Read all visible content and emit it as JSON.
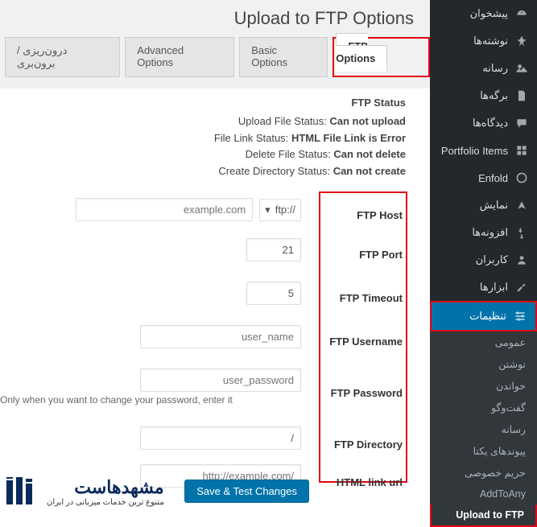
{
  "sidebar": {
    "items": [
      {
        "label": "پیشخوان",
        "icon": "dashboard-icon"
      },
      {
        "label": "نوشته‌ها",
        "icon": "pin-icon"
      },
      {
        "label": "رسانه",
        "icon": "media-icon"
      },
      {
        "label": "برگه‌ها",
        "icon": "page-icon"
      },
      {
        "label": "دیدگاه‌ها",
        "icon": "comment-icon"
      },
      {
        "label": "Portfolio Items",
        "icon": "gallery-icon"
      },
      {
        "label": "Enfold",
        "icon": "enfold-icon"
      },
      {
        "label": "نمایش",
        "icon": "appearance-icon"
      },
      {
        "label": "افزونه‌ها",
        "icon": "plugin-icon"
      },
      {
        "label": "کاربران",
        "icon": "users-icon"
      },
      {
        "label": "ابزارها",
        "icon": "tools-icon"
      },
      {
        "label": "تنظیمات",
        "icon": "settings-icon"
      }
    ],
    "subs": [
      "عمومی",
      "نوشتن",
      "خواندن",
      "گفت‌وگو",
      "رسانه",
      "پیوندهای یکتا",
      "حریم خصوصی",
      "AddToAny",
      "Upload to FTP"
    ]
  },
  "page": {
    "title": "Upload to FTP Options"
  },
  "tabs": [
    {
      "label": "درون‌ریزی / برون‌بری"
    },
    {
      "label": "Advanced Options"
    },
    {
      "label": "Basic Options"
    },
    {
      "label": "FTP Options",
      "active": true
    }
  ],
  "status": {
    "heading": "FTP Status",
    "lines": [
      {
        "label": "Upload File Status:",
        "value": "Can not upload"
      },
      {
        "label": "File Link Status:",
        "value": "HTML File Link is Error"
      },
      {
        "label": "Delete File Status:",
        "value": "Can not delete"
      },
      {
        "label": "Create Directory Status:",
        "value": "Can not create"
      }
    ]
  },
  "form": {
    "labels": [
      "FTP Host",
      "FTP Port",
      "FTP Timeout",
      "FTP Username",
      "FTP Password",
      "FTP Directory",
      "HTML link url"
    ],
    "protocol": "ftp:// ",
    "host_placeholder": "example.com",
    "port_value": "21",
    "timeout_value": "5",
    "username_placeholder": "user_name",
    "password_placeholder": "user_password",
    "password_hint": "Only when you want to change your password, enter it",
    "directory_value": "/",
    "url_placeholder": "http://example.com/"
  },
  "buttons": {
    "save": "Save & Test Changes"
  },
  "logo": {
    "title": "مشهدهاست",
    "sub": "متنوع ترین خدمات میزبانی در ایران"
  }
}
